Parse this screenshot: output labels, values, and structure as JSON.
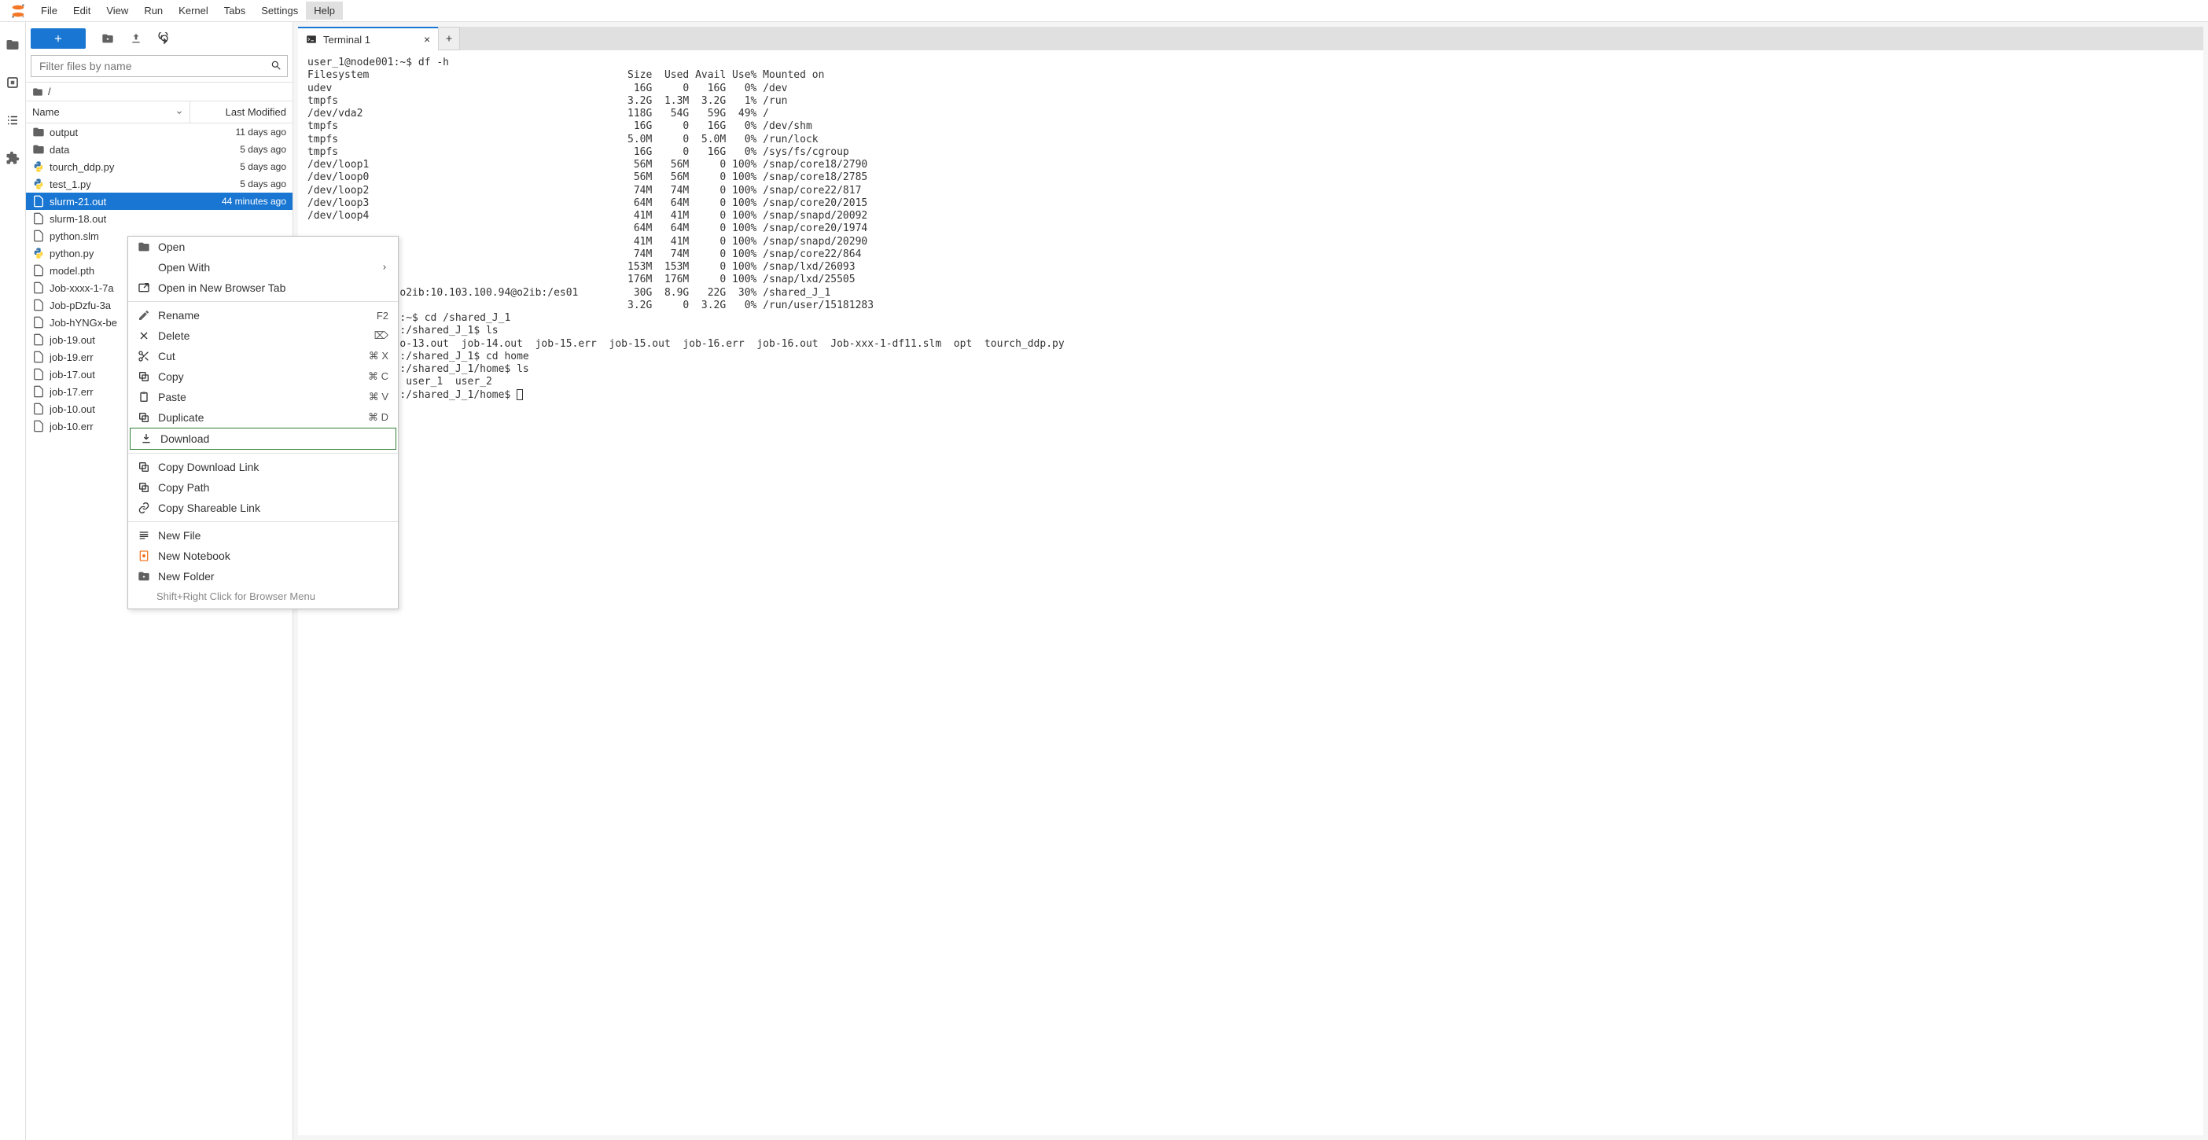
{
  "menubar": {
    "items": [
      "File",
      "Edit",
      "View",
      "Run",
      "Kernel",
      "Tabs",
      "Settings",
      "Help"
    ],
    "highlighted": "Help"
  },
  "filebrowser": {
    "filter_placeholder": "Filter files by name",
    "breadcrumb_root": "/",
    "header_name": "Name",
    "header_modified": "Last Modified",
    "items": [
      {
        "name": "output",
        "kind": "folder",
        "modified": "11 days ago"
      },
      {
        "name": "data",
        "kind": "folder",
        "modified": "5 days ago"
      },
      {
        "name": "tourch_ddp.py",
        "kind": "python",
        "modified": "5 days ago"
      },
      {
        "name": "test_1.py",
        "kind": "python",
        "modified": "5 days ago"
      },
      {
        "name": "slurm-21.out",
        "kind": "file",
        "modified": "44 minutes ago",
        "selected": true
      },
      {
        "name": "slurm-18.out",
        "kind": "file",
        "modified": ""
      },
      {
        "name": "python.slm",
        "kind": "file",
        "modified": ""
      },
      {
        "name": "python.py",
        "kind": "python",
        "modified": ""
      },
      {
        "name": "model.pth",
        "kind": "file",
        "modified": ""
      },
      {
        "name": "Job-xxxx-1-7a",
        "kind": "file",
        "modified": ""
      },
      {
        "name": "Job-pDzfu-3a",
        "kind": "file",
        "modified": ""
      },
      {
        "name": "Job-hYNGx-be",
        "kind": "file",
        "modified": ""
      },
      {
        "name": "job-19.out",
        "kind": "file",
        "modified": ""
      },
      {
        "name": "job-19.err",
        "kind": "file",
        "modified": ""
      },
      {
        "name": "job-17.out",
        "kind": "file",
        "modified": ""
      },
      {
        "name": "job-17.err",
        "kind": "file",
        "modified": ""
      },
      {
        "name": "job-10.out",
        "kind": "file",
        "modified": ""
      },
      {
        "name": "job-10.err",
        "kind": "file",
        "modified": ""
      }
    ]
  },
  "context_menu": {
    "groups": [
      [
        {
          "icon": "open-folder",
          "label": "Open"
        },
        {
          "icon": "",
          "label": "Open With",
          "submenu": true
        },
        {
          "icon": "open-tab",
          "label": "Open in New Browser Tab"
        }
      ],
      [
        {
          "icon": "pencil",
          "label": "Rename",
          "kbd": "F2"
        },
        {
          "icon": "x",
          "label": "Delete",
          "kbd": "⌦"
        },
        {
          "icon": "scissors",
          "label": "Cut",
          "kbd": "⌘ X"
        },
        {
          "icon": "copy",
          "label": "Copy",
          "kbd": "⌘ C"
        },
        {
          "icon": "paste",
          "label": "Paste",
          "kbd": "⌘ V"
        },
        {
          "icon": "duplicate",
          "label": "Duplicate",
          "kbd": "⌘ D"
        },
        {
          "icon": "download",
          "label": "Download",
          "highlight": true
        }
      ],
      [
        {
          "icon": "copy",
          "label": "Copy Download Link"
        },
        {
          "icon": "copy",
          "label": "Copy Path"
        },
        {
          "icon": "link",
          "label": "Copy Shareable Link"
        }
      ],
      [
        {
          "icon": "lines",
          "label": "New File"
        },
        {
          "icon": "notebook",
          "label": "New Notebook"
        },
        {
          "icon": "folder-plus",
          "label": "New Folder"
        }
      ]
    ],
    "tip": "Shift+Right Click for Browser Menu"
  },
  "tabs": {
    "active": {
      "title": "Terminal 1",
      "icon": "terminal"
    }
  },
  "terminal": {
    "lines": [
      "user_1@node001:~$ df -h",
      "Filesystem                                          Size  Used Avail Use% Mounted on",
      "udev                                                 16G     0   16G   0% /dev",
      "tmpfs                                               3.2G  1.3M  3.2G   1% /run",
      "/dev/vda2                                           118G   54G   59G  49% /",
      "tmpfs                                                16G     0   16G   0% /dev/shm",
      "tmpfs                                               5.0M     0  5.0M   0% /run/lock",
      "tmpfs                                                16G     0   16G   0% /sys/fs/cgroup",
      "/dev/loop1                                           56M   56M     0 100% /snap/core18/2790",
      "/dev/loop0                                           56M   56M     0 100% /snap/core18/2785",
      "/dev/loop2                                           74M   74M     0 100% /snap/core22/817",
      "/dev/loop3                                           64M   64M     0 100% /snap/core20/2015",
      "/dev/loop4                                           41M   41M     0 100% /snap/snapd/20092",
      "                                                     64M   64M     0 100% /snap/core20/1974",
      "                                                     41M   41M     0 100% /snap/snapd/20290",
      "                                                     74M   74M     0 100% /snap/core22/864",
      "                                                    153M  153M     0 100% /snap/lxd/26093",
      "                                                    176M  176M     0 100% /snap/lxd/25505",
      "               o2ib:10.103.100.94@o2ib:/es01         30G  8.9G   22G  30% /shared_J_1",
      "                                                    3.2G     0  3.2G   0% /run/user/15181283",
      "               :~$ cd /shared_J_1",
      "               :/shared_J_1$ ls",
      "               o-13.out  job-14.out  job-15.err  job-15.out  job-16.err  job-16.out  Job-xxx-1-df11.slm  opt  tourch_ddp.py",
      "               :/shared_J_1$ cd home",
      "               :/shared_J_1/home$ ls",
      "                user_1  user_2",
      "               :/shared_J_1/home$ "
    ]
  }
}
